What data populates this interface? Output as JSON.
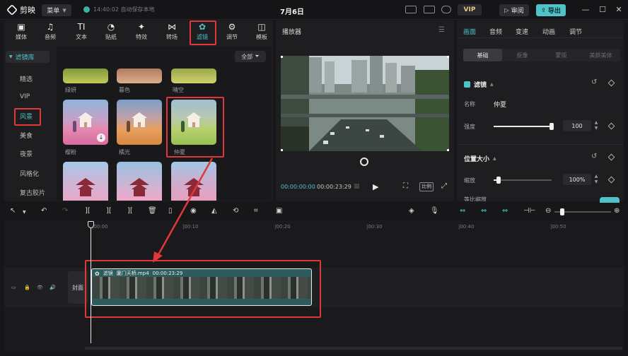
{
  "titlebar": {
    "app_name": "剪映",
    "menu_label": "菜单",
    "autosave_text": "14:40:02 自动保存本地",
    "doc_title": "7月6日",
    "vip_label": "VIP",
    "review_label": "审阅",
    "export_label": "导出"
  },
  "tools": [
    {
      "label": "媒体",
      "icon": "media-icon",
      "glyph": "▣"
    },
    {
      "label": "音频",
      "icon": "audio-icon",
      "glyph": "♫"
    },
    {
      "label": "文本",
      "icon": "text-icon",
      "glyph": "TI"
    },
    {
      "label": "贴纸",
      "icon": "sticker-icon",
      "glyph": "◔"
    },
    {
      "label": "特效",
      "icon": "effects-icon",
      "glyph": "✦"
    },
    {
      "label": "转场",
      "icon": "transition-icon",
      "glyph": "⋈"
    },
    {
      "label": "滤镜",
      "icon": "filter-icon",
      "glyph": "✿"
    },
    {
      "label": "调节",
      "icon": "adjust-icon",
      "glyph": "⚙"
    },
    {
      "label": "模板",
      "icon": "template-icon",
      "glyph": "◫"
    }
  ],
  "categories": {
    "header": "滤镜库",
    "items": [
      "精选",
      "VIP",
      "风景",
      "美食",
      "夜景",
      "风格化",
      "复古胶片"
    ]
  },
  "filter_panel": {
    "all_label": "全部",
    "row1_labels": [
      "绿妍",
      "暮色",
      "晴空"
    ],
    "row2_labels": [
      "樱粉",
      "橘光",
      "仲夏"
    ]
  },
  "player": {
    "title": "播放器",
    "current_time": "00:00:00:00",
    "total_time": "00:00:23:29",
    "ratio_label": "比例"
  },
  "right_panel": {
    "tabs": [
      "画面",
      "音频",
      "变速",
      "动画",
      "调节"
    ],
    "segments": [
      "基础",
      "抠像",
      "蒙版",
      "美颜美体"
    ],
    "filter_section": "滤镜",
    "name_label": "名称",
    "name_value": "仲夏",
    "strength_label": "强度",
    "strength_value": "100",
    "strength_fraction": 1.0,
    "position_section": "位置大小",
    "scale_label": "缩放",
    "scale_value": "100%",
    "scale_fraction": 0.08,
    "next_section": "等比缩放"
  },
  "timeline": {
    "ruler_labels": [
      "|00:00",
      "|00:10",
      "|00:20",
      "|00:30",
      "|00:40",
      "|00:50"
    ],
    "cover_label": "封面",
    "clip_filter_tag": "滤镜",
    "clip_name": "厦门天桥.mp4",
    "clip_duration": "00:00:23:29"
  },
  "colors": {
    "accent": "#4fc3c8",
    "highlight_box": "#e0373a"
  }
}
